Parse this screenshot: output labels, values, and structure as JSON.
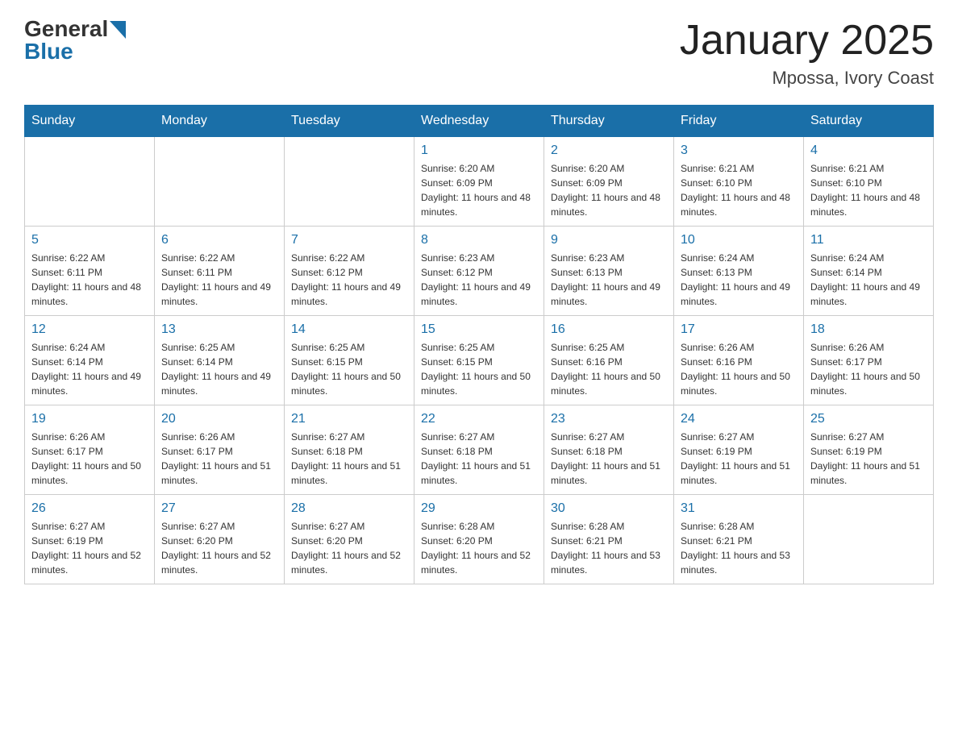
{
  "header": {
    "logo": {
      "general": "General",
      "blue": "Blue"
    },
    "title": "January 2025",
    "location": "Mpossa, Ivory Coast"
  },
  "weekdays": [
    "Sunday",
    "Monday",
    "Tuesday",
    "Wednesday",
    "Thursday",
    "Friday",
    "Saturday"
  ],
  "weeks": [
    [
      {
        "day": "",
        "info": ""
      },
      {
        "day": "",
        "info": ""
      },
      {
        "day": "",
        "info": ""
      },
      {
        "day": "1",
        "info": "Sunrise: 6:20 AM\nSunset: 6:09 PM\nDaylight: 11 hours and 48 minutes."
      },
      {
        "day": "2",
        "info": "Sunrise: 6:20 AM\nSunset: 6:09 PM\nDaylight: 11 hours and 48 minutes."
      },
      {
        "day": "3",
        "info": "Sunrise: 6:21 AM\nSunset: 6:10 PM\nDaylight: 11 hours and 48 minutes."
      },
      {
        "day": "4",
        "info": "Sunrise: 6:21 AM\nSunset: 6:10 PM\nDaylight: 11 hours and 48 minutes."
      }
    ],
    [
      {
        "day": "5",
        "info": "Sunrise: 6:22 AM\nSunset: 6:11 PM\nDaylight: 11 hours and 48 minutes."
      },
      {
        "day": "6",
        "info": "Sunrise: 6:22 AM\nSunset: 6:11 PM\nDaylight: 11 hours and 49 minutes."
      },
      {
        "day": "7",
        "info": "Sunrise: 6:22 AM\nSunset: 6:12 PM\nDaylight: 11 hours and 49 minutes."
      },
      {
        "day": "8",
        "info": "Sunrise: 6:23 AM\nSunset: 6:12 PM\nDaylight: 11 hours and 49 minutes."
      },
      {
        "day": "9",
        "info": "Sunrise: 6:23 AM\nSunset: 6:13 PM\nDaylight: 11 hours and 49 minutes."
      },
      {
        "day": "10",
        "info": "Sunrise: 6:24 AM\nSunset: 6:13 PM\nDaylight: 11 hours and 49 minutes."
      },
      {
        "day": "11",
        "info": "Sunrise: 6:24 AM\nSunset: 6:14 PM\nDaylight: 11 hours and 49 minutes."
      }
    ],
    [
      {
        "day": "12",
        "info": "Sunrise: 6:24 AM\nSunset: 6:14 PM\nDaylight: 11 hours and 49 minutes."
      },
      {
        "day": "13",
        "info": "Sunrise: 6:25 AM\nSunset: 6:14 PM\nDaylight: 11 hours and 49 minutes."
      },
      {
        "day": "14",
        "info": "Sunrise: 6:25 AM\nSunset: 6:15 PM\nDaylight: 11 hours and 50 minutes."
      },
      {
        "day": "15",
        "info": "Sunrise: 6:25 AM\nSunset: 6:15 PM\nDaylight: 11 hours and 50 minutes."
      },
      {
        "day": "16",
        "info": "Sunrise: 6:25 AM\nSunset: 6:16 PM\nDaylight: 11 hours and 50 minutes."
      },
      {
        "day": "17",
        "info": "Sunrise: 6:26 AM\nSunset: 6:16 PM\nDaylight: 11 hours and 50 minutes."
      },
      {
        "day": "18",
        "info": "Sunrise: 6:26 AM\nSunset: 6:17 PM\nDaylight: 11 hours and 50 minutes."
      }
    ],
    [
      {
        "day": "19",
        "info": "Sunrise: 6:26 AM\nSunset: 6:17 PM\nDaylight: 11 hours and 50 minutes."
      },
      {
        "day": "20",
        "info": "Sunrise: 6:26 AM\nSunset: 6:17 PM\nDaylight: 11 hours and 51 minutes."
      },
      {
        "day": "21",
        "info": "Sunrise: 6:27 AM\nSunset: 6:18 PM\nDaylight: 11 hours and 51 minutes."
      },
      {
        "day": "22",
        "info": "Sunrise: 6:27 AM\nSunset: 6:18 PM\nDaylight: 11 hours and 51 minutes."
      },
      {
        "day": "23",
        "info": "Sunrise: 6:27 AM\nSunset: 6:18 PM\nDaylight: 11 hours and 51 minutes."
      },
      {
        "day": "24",
        "info": "Sunrise: 6:27 AM\nSunset: 6:19 PM\nDaylight: 11 hours and 51 minutes."
      },
      {
        "day": "25",
        "info": "Sunrise: 6:27 AM\nSunset: 6:19 PM\nDaylight: 11 hours and 51 minutes."
      }
    ],
    [
      {
        "day": "26",
        "info": "Sunrise: 6:27 AM\nSunset: 6:19 PM\nDaylight: 11 hours and 52 minutes."
      },
      {
        "day": "27",
        "info": "Sunrise: 6:27 AM\nSunset: 6:20 PM\nDaylight: 11 hours and 52 minutes."
      },
      {
        "day": "28",
        "info": "Sunrise: 6:27 AM\nSunset: 6:20 PM\nDaylight: 11 hours and 52 minutes."
      },
      {
        "day": "29",
        "info": "Sunrise: 6:28 AM\nSunset: 6:20 PM\nDaylight: 11 hours and 52 minutes."
      },
      {
        "day": "30",
        "info": "Sunrise: 6:28 AM\nSunset: 6:21 PM\nDaylight: 11 hours and 53 minutes."
      },
      {
        "day": "31",
        "info": "Sunrise: 6:28 AM\nSunset: 6:21 PM\nDaylight: 11 hours and 53 minutes."
      },
      {
        "day": "",
        "info": ""
      }
    ]
  ]
}
